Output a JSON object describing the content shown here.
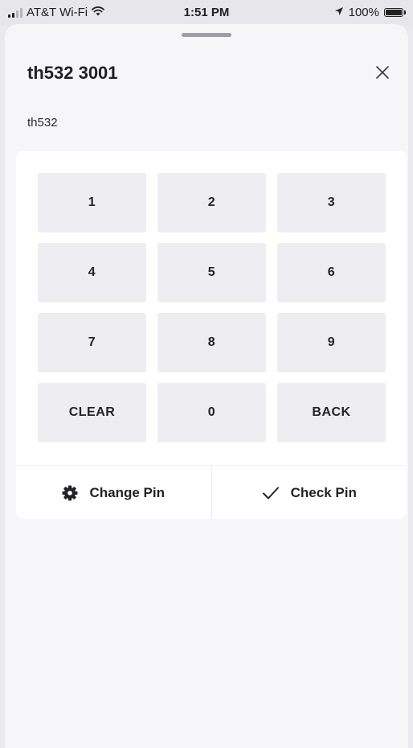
{
  "status_bar": {
    "carrier": "AT&T Wi-Fi",
    "time": "1:51 PM",
    "battery": "100%",
    "icons": [
      "signal-icon",
      "wifi-icon",
      "location-arrow-icon",
      "battery-icon"
    ]
  },
  "sheet": {
    "title": "th532 3001",
    "subtitle": "th532",
    "close_icon": "close-icon"
  },
  "keypad": {
    "keys": [
      "1",
      "2",
      "3",
      "4",
      "5",
      "6",
      "7",
      "8",
      "9",
      "CLEAR",
      "0",
      "BACK"
    ]
  },
  "actions": {
    "change_pin": {
      "label": "Change Pin",
      "icon": "gear-icon"
    },
    "check_pin": {
      "label": "Check Pin",
      "icon": "checkmark-icon"
    }
  },
  "colors": {
    "background": "#e9e9ee",
    "sheet": "#f6f6f8",
    "card": "#ffffff",
    "key": "#eeeef2",
    "text": "#1f1f24"
  }
}
